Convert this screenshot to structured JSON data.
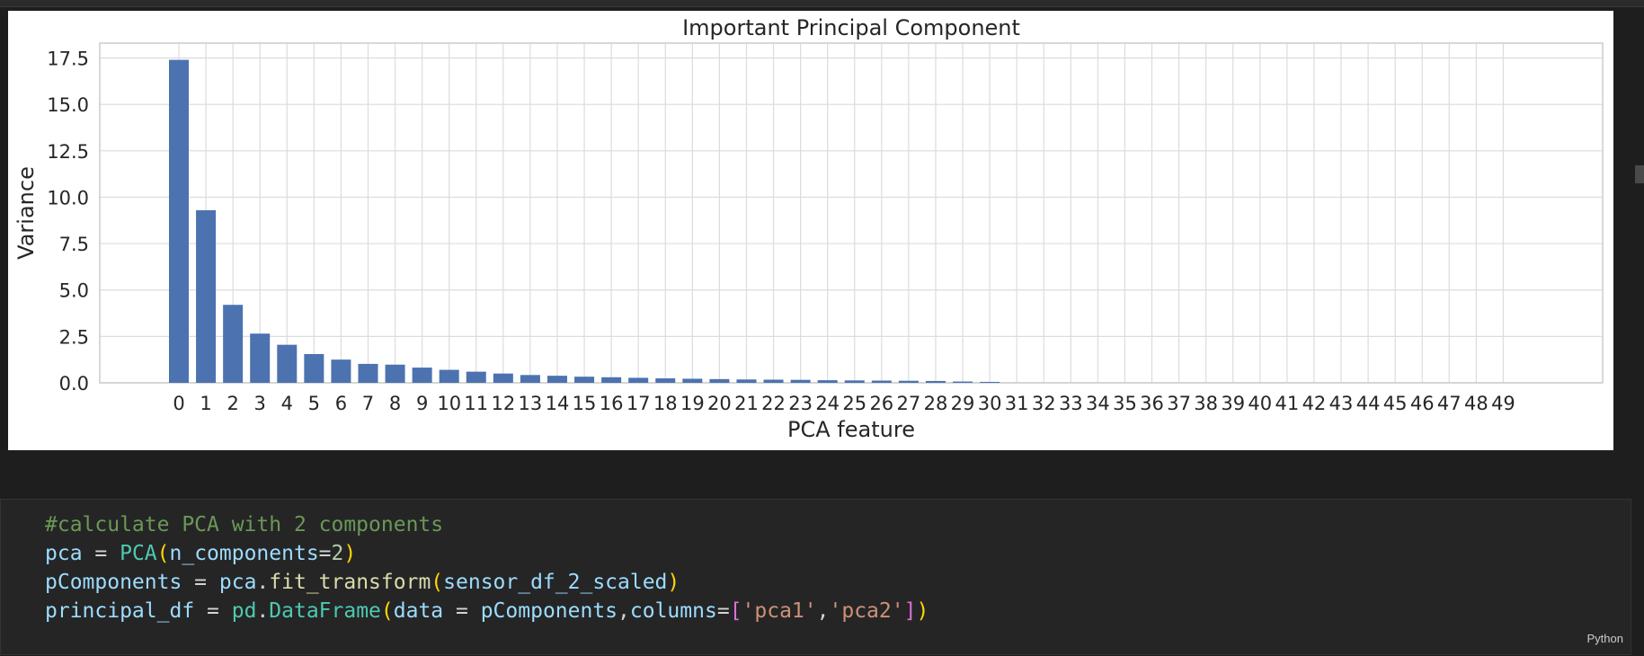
{
  "chart_data": {
    "type": "bar",
    "title": "Important Principal Component",
    "xlabel": "PCA feature",
    "ylabel": "Variance",
    "ylim": [
      0,
      18.3
    ],
    "yticks": [
      "0.0",
      "2.5",
      "5.0",
      "7.5",
      "10.0",
      "12.5",
      "15.0",
      "17.5"
    ],
    "grid": true,
    "bar_color": "#4c72b0",
    "categories": [
      "0",
      "1",
      "2",
      "3",
      "4",
      "5",
      "6",
      "7",
      "8",
      "9",
      "10",
      "11",
      "12",
      "13",
      "14",
      "15",
      "16",
      "17",
      "18",
      "19",
      "20",
      "21",
      "22",
      "23",
      "24",
      "25",
      "26",
      "27",
      "28",
      "29",
      "30",
      "31",
      "32",
      "33",
      "34",
      "35",
      "36",
      "37",
      "38",
      "39",
      "40",
      "41",
      "42",
      "43",
      "44",
      "45",
      "46",
      "47",
      "48",
      "49"
    ],
    "values": [
      17.4,
      9.3,
      4.2,
      2.65,
      2.05,
      1.55,
      1.25,
      1.02,
      0.98,
      0.82,
      0.7,
      0.6,
      0.5,
      0.42,
      0.38,
      0.33,
      0.3,
      0.27,
      0.24,
      0.22,
      0.2,
      0.18,
      0.17,
      0.16,
      0.14,
      0.13,
      0.12,
      0.11,
      0.1,
      0.07,
      0.05,
      0,
      0,
      0,
      0,
      0,
      0,
      0,
      0,
      0,
      0,
      0,
      0,
      0,
      0,
      0,
      0,
      0,
      0,
      0
    ]
  },
  "code_cell": {
    "language": "Python",
    "lines": [
      "#calculate PCA with 2 components",
      "pca = PCA(n_components=2)",
      "pComponents = pca.fit_transform(sensor_df_2_scaled)",
      "principal_df = pd.DataFrame(data = pComponents,columns=['pca1','pca2'])"
    ]
  },
  "colors": {
    "background": "#1e1e1e",
    "cell_background": "#252526",
    "comment": "#6a9955",
    "variable": "#9cdcfe",
    "class": "#4ec9b0",
    "function": "#dcdcaa",
    "number": "#b5cea8",
    "string": "#ce9178"
  }
}
